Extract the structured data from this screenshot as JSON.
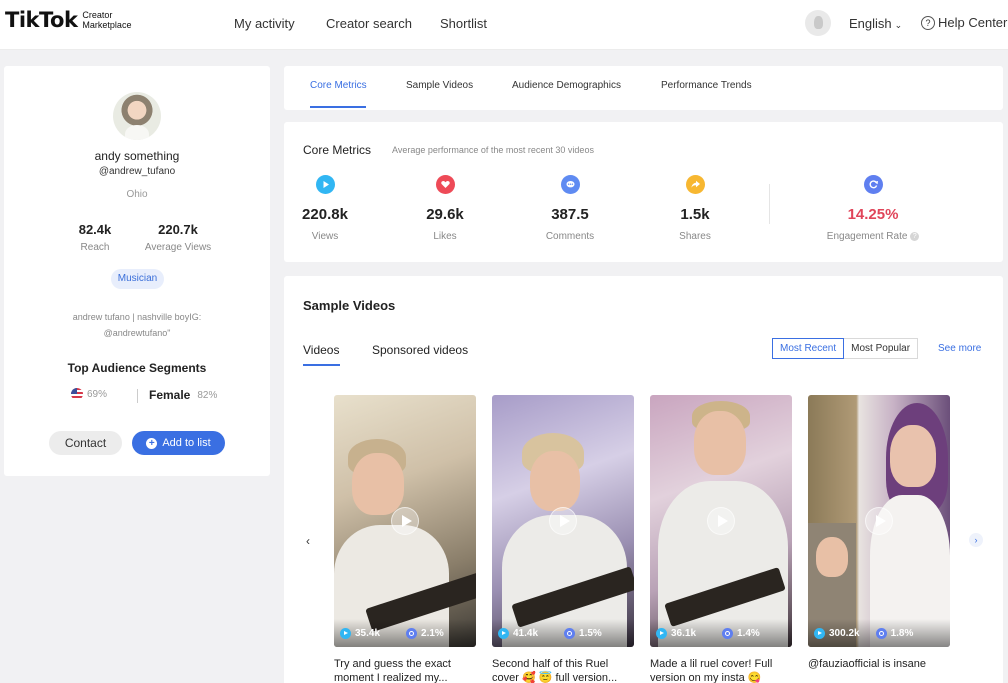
{
  "nav": {
    "logo_main": "TikTok",
    "logo_sub_line1": "Creator",
    "logo_sub_line2": "Marketplace",
    "links": [
      "My activity",
      "Creator search",
      "Shortlist"
    ],
    "language": "English",
    "help": "Help Center"
  },
  "profile": {
    "name": "andy something",
    "handle": "@andrew_tufano",
    "location": "Ohio",
    "reach_value": "82.4k",
    "reach_label": "Reach",
    "avg_views_value": "220.7k",
    "avg_views_label": "Average Views",
    "tag": "Musician",
    "bio_line1": "andrew tufano | nashville boyIG:",
    "bio_line2": "@andrewtufano\"",
    "segments_title": "Top Audience Segments",
    "segment_country_pct": "69%",
    "segment_gender": "Female",
    "segment_gender_pct": "82%",
    "contact_label": "Contact",
    "add_label": "Add to list"
  },
  "tabs": [
    "Core Metrics",
    "Sample Videos",
    "Audience Demographics",
    "Performance Trends"
  ],
  "core": {
    "title": "Core Metrics",
    "subtitle": "Average performance of the most recent 30 videos",
    "metrics": [
      {
        "value": "220.8k",
        "label": "Views",
        "color": "#31b6f3",
        "icon": "play-icon"
      },
      {
        "value": "29.6k",
        "label": "Likes",
        "color": "#ee4a57",
        "icon": "heart-icon"
      },
      {
        "value": "387.5",
        "label": "Comments",
        "color": "#5f8bf2",
        "icon": "comment-icon"
      },
      {
        "value": "1.5k",
        "label": "Shares",
        "color": "#f7b731",
        "icon": "share-icon"
      },
      {
        "value": "14.25%",
        "label": "Engagement Rate",
        "color": "#5f7ff0",
        "icon": "engagement-icon"
      }
    ]
  },
  "samples": {
    "title": "Sample Videos",
    "subtabs": [
      "Videos",
      "Sponsored videos"
    ],
    "sort_recent": "Most Recent",
    "sort_popular": "Most Popular",
    "see_more": "See more",
    "videos": [
      {
        "views": "35.4k",
        "engagement": "2.1%",
        "caption": "Try and guess the exact moment I realized my..."
      },
      {
        "views": "41.4k",
        "engagement": "1.5%",
        "caption": "Second half of this Ruel cover 🥰 😇  full version..."
      },
      {
        "views": "36.1k",
        "engagement": "1.4%",
        "caption": "Made a lil ruel cover! Full version on my insta 😋"
      },
      {
        "views": "300.2k",
        "engagement": "1.8%",
        "caption": "@fauziaofficial is insane"
      }
    ]
  }
}
